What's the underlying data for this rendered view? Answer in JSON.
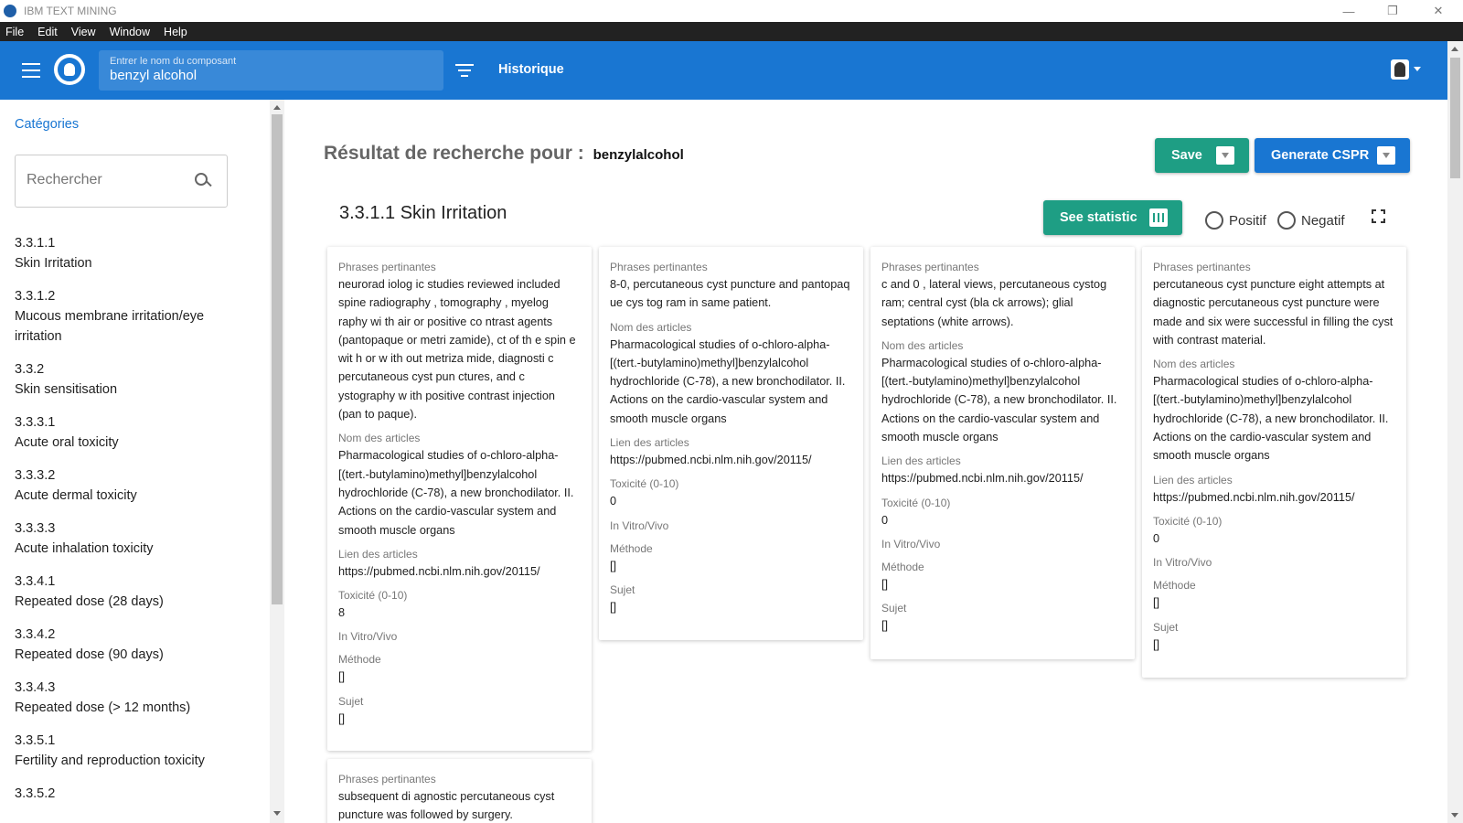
{
  "window": {
    "title": "IBM TEXT MINING"
  },
  "menu": [
    "File",
    "Edit",
    "View",
    "Window",
    "Help"
  ],
  "appbar": {
    "search_label": "Entrer le nom du composant",
    "search_value": "benzyl alcohol",
    "historique": "Historique"
  },
  "sidebar": {
    "title": "Catégories",
    "search_placeholder": "Rechercher",
    "items": [
      {
        "num": "3.3.1.1",
        "label": "Skin Irritation"
      },
      {
        "num": "3.3.1.2",
        "label": "Mucous membrane irritation/eye irritation"
      },
      {
        "num": "3.3.2",
        "label": "Skin sensitisation"
      },
      {
        "num": "3.3.3.1",
        "label": "Acute oral toxicity"
      },
      {
        "num": "3.3.3.2",
        "label": "Acute dermal toxicity"
      },
      {
        "num": "3.3.3.3",
        "label": "Acute inhalation toxicity"
      },
      {
        "num": "3.3.4.1",
        "label": "Repeated dose (28 days)"
      },
      {
        "num": "3.3.4.2",
        "label": "Repeated dose (90 days)"
      },
      {
        "num": "3.3.4.3",
        "label": "Repeated dose (> 12 months)"
      },
      {
        "num": "3.3.5.1",
        "label": "Fertility and reproduction toxicity"
      },
      {
        "num": "3.3.5.2",
        "label": ""
      }
    ]
  },
  "main": {
    "result_label": "Résultat de recherche pour :",
    "result_term": "benzylalcohol",
    "save_label": "Save",
    "cspr_label": "Generate CSPR",
    "section_title": "3.3.1.1 Skin Irritation",
    "stat_label": "See statistic",
    "radio_pos": "Positif",
    "radio_neg": "Negatif"
  },
  "labels": {
    "phrases": "Phrases pertinantes",
    "noms": "Nom des articles",
    "liens": "Lien des articles",
    "toxicite": "Toxicité (0-10)",
    "vitro": "In Vitro/Vivo",
    "methode": "Méthode",
    "sujet": "Sujet"
  },
  "cards": [
    {
      "phrases": "neurorad iolog ic studies reviewed included spine radiography , tomography , myelog raphy wi th air or positive co ntrast agents (pantopaque or metri zamide), ct of th e spin e wit h or w ith out metriza mide, diagnosti c percutaneous cyst pun ctures, and c ystography w ith positive contrast injection (pan to paque).",
      "noms": "Pharmacological studies of o-chloro-alpha-[(tert.-butylamino)methyl]benzylalcohol hydrochloride (C-78), a new bronchodilator. II. Actions on the cardio-vascular system and smooth muscle organs",
      "lien": "https://pubmed.ncbi.nlm.nih.gov/20115/",
      "toxicite": "8",
      "vitro": "",
      "methode": "[]",
      "sujet": "[]"
    },
    {
      "phrases": "8-0, percutaneous cyst puncture and pantopaq ue cys tog ram in same patient.",
      "noms": "Pharmacological studies of o-chloro-alpha-[(tert.-butylamino)methyl]benzylalcohol hydrochloride (C-78), a new bronchodilator. II. Actions on the cardio-vascular system and smooth muscle organs",
      "lien": "https://pubmed.ncbi.nlm.nih.gov/20115/",
      "toxicite": "0",
      "vitro": "",
      "methode": "[]",
      "sujet": "[]"
    },
    {
      "phrases": "c and 0 , lateral views, percutaneous cystog ram; central cyst (bla ck arrows); glial septations (white arrows).",
      "noms": "Pharmacological studies of o-chloro-alpha-[(tert.-butylamino)methyl]benzylalcohol hydrochloride (C-78), a new bronchodilator. II. Actions on the cardio-vascular system and smooth muscle organs",
      "lien": "https://pubmed.ncbi.nlm.nih.gov/20115/",
      "toxicite": "0",
      "vitro": "",
      "methode": "[]",
      "sujet": "[]"
    },
    {
      "phrases": "percutaneous cyst puncture eight attempts at diagnostic percutaneous cyst puncture were made and six were successful in filling the cyst with contrast material.",
      "noms": "Pharmacological studies of o-chloro-alpha-[(tert.-butylamino)methyl]benzylalcohol hydrochloride (C-78), a new bronchodilator. II. Actions on the cardio-vascular system and smooth muscle organs",
      "lien": "https://pubmed.ncbi.nlm.nih.gov/20115/",
      "toxicite": "0",
      "vitro": "",
      "methode": "[]",
      "sujet": "[]"
    },
    {
      "phrases": "subsequent di agnostic percutaneous cyst puncture was followed by surgery."
    }
  ]
}
